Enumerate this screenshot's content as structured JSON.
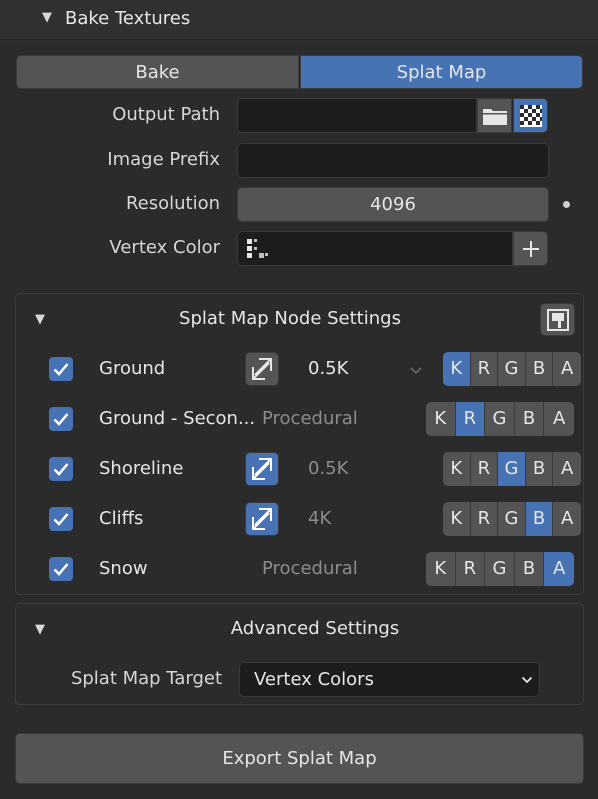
{
  "panel": {
    "title": "Bake Textures"
  },
  "tabs": [
    {
      "label": "Bake",
      "active": false
    },
    {
      "label": "Splat Map",
      "active": true
    }
  ],
  "props": {
    "output_path": {
      "label": "Output Path",
      "value": ""
    },
    "image_prefix": {
      "label": "Image Prefix",
      "value": ""
    },
    "resolution": {
      "label": "Resolution",
      "value": "4096"
    },
    "vertex_color": {
      "label": "Vertex Color",
      "value": ""
    }
  },
  "node_settings": {
    "title": "Splat Map Node Settings",
    "rows": [
      {
        "name": "Ground",
        "checked": true,
        "swap_active": false,
        "resolution": "0.5K",
        "procedural": "",
        "channels": [
          "K",
          "R",
          "G",
          "B",
          "A"
        ],
        "active_channel": "K"
      },
      {
        "name": "Ground - Secon...",
        "checked": true,
        "swap_active": null,
        "resolution": "",
        "procedural": "Procedural",
        "channels": [
          "K",
          "R",
          "G",
          "B",
          "A"
        ],
        "active_channel": "R"
      },
      {
        "name": "Shoreline",
        "checked": true,
        "swap_active": true,
        "resolution": "0.5K",
        "procedural": "",
        "channels": [
          "K",
          "R",
          "G",
          "B",
          "A"
        ],
        "active_channel": "G"
      },
      {
        "name": "Cliffs",
        "checked": true,
        "swap_active": true,
        "resolution": "4K",
        "procedural": "",
        "channels": [
          "K",
          "R",
          "G",
          "B",
          "A"
        ],
        "active_channel": "B"
      },
      {
        "name": "Snow",
        "checked": true,
        "swap_active": null,
        "resolution": "",
        "procedural": "Procedural",
        "channels": [
          "K",
          "R",
          "G",
          "B",
          "A"
        ],
        "active_channel": "A"
      }
    ]
  },
  "advanced": {
    "title": "Advanced Settings",
    "target_label": "Splat Map Target",
    "target_value": "Vertex Colors"
  },
  "export_label": "Export Splat Map",
  "colors": {
    "accent": "#4772b3",
    "button": "#545454",
    "field": "#1d1d1d",
    "panel": "#2b2b2b"
  }
}
